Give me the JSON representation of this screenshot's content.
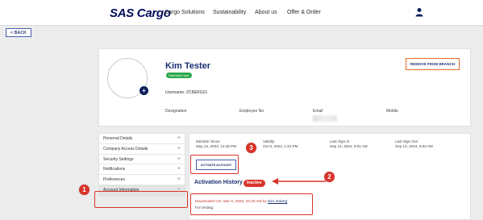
{
  "header": {
    "brand": "SAS Cargo",
    "nav": [
      "Cargo Solutions",
      "Sustainability",
      "About us",
      "Offer & Order"
    ]
  },
  "back_label": "< BACK",
  "profile": {
    "name": "Kim Tester",
    "role_badge": "Standard User",
    "username_label": "Username: ZCBERG01",
    "remove_label": "REMOVE FROM BRANCH",
    "fields": [
      "Designation",
      "Employee No.",
      "Email",
      "Mobile"
    ]
  },
  "menu": [
    {
      "label": "Personal Details",
      "sign": "+"
    },
    {
      "label": "Company Access Details",
      "sign": "+"
    },
    {
      "label": "Security Settings",
      "sign": "+"
    },
    {
      "label": "Notifications",
      "sign": "+"
    },
    {
      "label": "Preferences",
      "sign": "+"
    },
    {
      "label": "Account Information",
      "sign": "−"
    }
  ],
  "account": {
    "member_since_label": "Member Since",
    "member_since": "May 24, 2024, 12:35 PM",
    "validity_label": "Validity",
    "validity": "Oct 8, 2024, 1:42 PM",
    "last_sign_in_label": "Last Sign In",
    "last_sign_in": "Sep 13, 2024, 9:01 AM",
    "last_sign_out_label": "Last Sign Out",
    "last_sign_out": "Sep 13, 2024, 9:03 AM",
    "activate_label": "ACTIVATE ACCOUNT",
    "history_title": "Activation History",
    "status_badge": "Inactive",
    "deactivated_text": "Deactivated On: Mar 5, 2026, 10:20 AM by",
    "deactivated_by": "Kim Zoberg",
    "reason": "For testing"
  },
  "annotations": [
    "1",
    "2",
    "3"
  ],
  "colors": {
    "accent": "#1a2f73",
    "annotation": "#d9342b",
    "badge_green": "#2aa84a"
  }
}
